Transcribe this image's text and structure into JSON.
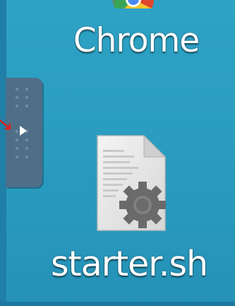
{
  "desktop": {
    "icons": [
      {
        "label": "Chrome",
        "icon": "chrome-icon"
      },
      {
        "label": "starter.sh",
        "icon": "shell-script-file-icon"
      }
    ],
    "panel_handle": {
      "icon": "expand-arrow-icon"
    }
  },
  "colors": {
    "background": "#2a9dc1",
    "panel": "#4f6e88",
    "label_text": "#ffffff",
    "annotation": "#e02020"
  }
}
